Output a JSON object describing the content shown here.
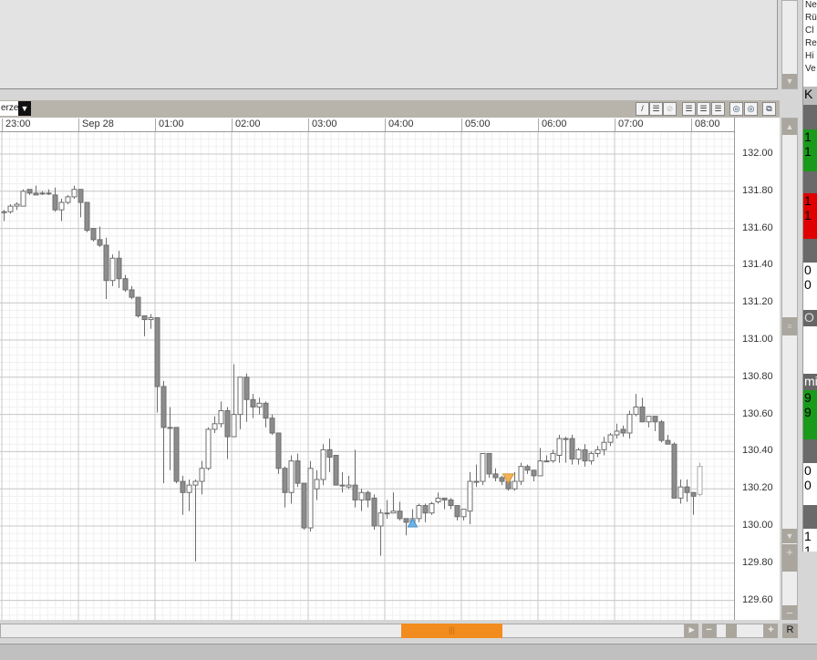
{
  "toolbar": {
    "instrument_label": "erze",
    "dropdown_icon": "▼",
    "tools": [
      "/",
      "☰",
      "⊘",
      "☰",
      "☰",
      "☰",
      "◎",
      "◎",
      "⧉"
    ]
  },
  "time_axis": {
    "labels": [
      "23:00",
      "Sep 28",
      "01:00",
      "02:00",
      "03:00",
      "04:00",
      "05:00",
      "06:00",
      "07:00",
      "08:00"
    ]
  },
  "price_axis": {
    "labels": [
      "132.00",
      "131.80",
      "131.60",
      "131.40",
      "131.20",
      "131.00",
      "130.80",
      "130.60",
      "130.40",
      "130.20",
      "130.00",
      "129.80",
      "129.60"
    ]
  },
  "scroll": {
    "thumb_grip": "|||",
    "reset_label": "R",
    "plus": "+",
    "minus": "−",
    "right_arrow": "▸"
  },
  "right_panel": {
    "rows": [
      "Ne",
      "Rü",
      "Cl",
      "Re",
      "Hi",
      "Ve"
    ],
    "header": "K",
    "blocks": [
      {
        "lines": [
          "1",
          "1"
        ],
        "color": "#1a9a1a",
        "fg": "#000"
      },
      {
        "lines": [
          "1",
          "1"
        ],
        "color": "#e00000",
        "fg": "#000"
      },
      {
        "lines": [
          "0",
          "0"
        ],
        "color": "#ffffff",
        "fg": "#000"
      },
      {
        "lines": [
          "O"
        ],
        "color": "#666666",
        "fg": "#ddd"
      },
      {
        "lines": [
          "mi"
        ],
        "color": "#666666",
        "fg": "#fff"
      },
      {
        "lines": [
          "9",
          "9"
        ],
        "color": "#1a9a1a",
        "fg": "#000"
      },
      {
        "lines": [
          "0",
          "0"
        ],
        "color": "#ffffff",
        "fg": "#000"
      },
      {
        "lines": [
          "1",
          "1"
        ],
        "color": "#ffffff",
        "fg": "#000"
      }
    ]
  },
  "chart_data": {
    "type": "candlestick",
    "interval": "5min",
    "ylim": [
      129.5,
      132.06
    ],
    "y_ticks": [
      132.0,
      131.8,
      131.6,
      131.4,
      131.2,
      131.0,
      130.8,
      130.6,
      130.4,
      130.2,
      130.0,
      129.8,
      129.6
    ],
    "colors": {
      "up_fill": "#ffffff",
      "down_fill": "#8c8c8c",
      "stroke": "#6e6e6e",
      "buy_marker": "#6cb4e8",
      "sell_marker": "#f2b456"
    },
    "markers": [
      {
        "index": 64,
        "type": "buy"
      },
      {
        "index": 79,
        "type": "sell"
      }
    ],
    "ohlc": [
      [
        131.69,
        131.7,
        131.64,
        131.69
      ],
      [
        131.69,
        131.73,
        131.68,
        131.72
      ],
      [
        131.72,
        131.74,
        131.7,
        131.73
      ],
      [
        131.72,
        131.81,
        131.72,
        131.8
      ],
      [
        131.81,
        131.81,
        131.78,
        131.79
      ],
      [
        131.79,
        131.83,
        131.78,
        131.78
      ],
      [
        131.79,
        131.8,
        131.78,
        131.79
      ],
      [
        131.79,
        131.81,
        131.78,
        131.79
      ],
      [
        131.78,
        131.82,
        131.69,
        131.7
      ],
      [
        131.7,
        131.76,
        131.64,
        131.74
      ],
      [
        131.74,
        131.78,
        131.73,
        131.77
      ],
      [
        131.77,
        131.83,
        131.76,
        131.81
      ],
      [
        131.81,
        131.81,
        131.66,
        131.74
      ],
      [
        131.74,
        131.74,
        131.58,
        131.59
      ],
      [
        131.6,
        131.6,
        131.53,
        131.54
      ],
      [
        131.54,
        131.61,
        131.5,
        131.51
      ],
      [
        131.51,
        131.55,
        131.22,
        131.32
      ],
      [
        131.32,
        131.46,
        131.29,
        131.44
      ],
      [
        131.44,
        131.48,
        131.28,
        131.33
      ],
      [
        131.33,
        131.35,
        131.26,
        131.27
      ],
      [
        131.27,
        131.29,
        131.22,
        131.23
      ],
      [
        131.23,
        131.23,
        131.12,
        131.13
      ],
      [
        131.13,
        131.13,
        131.02,
        131.11
      ],
      [
        131.11,
        131.14,
        131.06,
        131.12
      ],
      [
        131.12,
        131.12,
        130.61,
        130.75
      ],
      [
        130.75,
        130.78,
        130.23,
        130.53
      ],
      [
        130.53,
        130.64,
        130.3,
        130.53
      ],
      [
        130.53,
        130.53,
        130.23,
        130.24
      ],
      [
        130.24,
        130.27,
        130.06,
        130.18
      ],
      [
        130.18,
        130.25,
        130.08,
        130.22
      ],
      [
        130.22,
        130.25,
        129.81,
        130.24
      ],
      [
        130.24,
        130.35,
        130.17,
        130.31
      ],
      [
        130.31,
        130.53,
        130.3,
        130.52
      ],
      [
        130.52,
        130.59,
        130.5,
        130.55
      ],
      [
        130.55,
        130.67,
        130.53,
        130.62
      ],
      [
        130.62,
        130.64,
        130.36,
        130.48
      ],
      [
        130.48,
        130.87,
        130.48,
        130.6
      ],
      [
        130.6,
        130.8,
        130.52,
        130.8
      ],
      [
        130.8,
        130.82,
        130.56,
        130.68
      ],
      [
        130.68,
        130.71,
        130.58,
        130.64
      ],
      [
        130.64,
        130.69,
        130.6,
        130.66
      ],
      [
        130.66,
        130.67,
        130.53,
        130.58
      ],
      [
        130.58,
        130.6,
        130.49,
        130.5
      ],
      [
        130.5,
        130.5,
        130.28,
        130.31
      ],
      [
        130.31,
        130.32,
        130.1,
        130.18
      ],
      [
        130.18,
        130.38,
        130.12,
        130.35
      ],
      [
        130.35,
        130.39,
        130.21,
        130.23
      ],
      [
        130.23,
        130.23,
        129.98,
        129.99
      ],
      [
        129.99,
        130.35,
        129.97,
        130.31
      ],
      [
        130.2,
        130.3,
        130.14,
        130.25
      ],
      [
        130.25,
        130.44,
        130.22,
        130.41
      ],
      [
        130.41,
        130.47,
        130.29,
        130.37
      ],
      [
        130.38,
        130.38,
        130.22,
        130.22
      ],
      [
        130.22,
        130.29,
        130.18,
        130.22
      ],
      [
        130.21,
        130.27,
        130.2,
        130.22
      ],
      [
        130.22,
        130.41,
        130.1,
        130.14
      ],
      [
        130.14,
        130.2,
        130.08,
        130.18
      ],
      [
        130.18,
        130.19,
        130.1,
        130.14
      ],
      [
        130.15,
        130.17,
        129.98,
        130.0
      ],
      [
        130.0,
        130.09,
        129.84,
        130.07
      ],
      [
        130.07,
        130.14,
        130.04,
        130.07
      ],
      [
        130.07,
        130.18,
        130.07,
        130.08
      ],
      [
        130.08,
        130.13,
        130.03,
        130.04
      ],
      [
        130.04,
        130.04,
        129.95,
        130.02
      ],
      [
        130.02,
        130.09,
        130.01,
        130.04
      ],
      [
        130.04,
        130.12,
        130.02,
        130.11
      ],
      [
        130.11,
        130.12,
        130.02,
        130.07
      ],
      [
        130.07,
        130.13,
        130.06,
        130.12
      ],
      [
        130.13,
        130.18,
        130.12,
        130.15
      ],
      [
        130.15,
        130.15,
        130.09,
        130.14
      ],
      [
        130.14,
        130.15,
        130.09,
        130.11
      ],
      [
        130.11,
        130.11,
        130.03,
        130.05
      ],
      [
        130.05,
        130.09,
        130.03,
        130.09
      ],
      [
        130.08,
        130.29,
        130.01,
        130.24
      ],
      [
        130.24,
        130.33,
        130.21,
        130.24
      ],
      [
        130.24,
        130.39,
        130.22,
        130.39
      ],
      [
        130.39,
        130.39,
        130.26,
        130.28
      ],
      [
        130.28,
        130.31,
        130.24,
        130.26
      ],
      [
        130.26,
        130.27,
        130.22,
        130.24
      ],
      [
        130.24,
        130.27,
        130.19,
        130.2
      ],
      [
        130.2,
        130.29,
        130.19,
        130.24
      ],
      [
        130.24,
        130.34,
        130.22,
        130.32
      ],
      [
        130.32,
        130.33,
        130.28,
        130.3
      ],
      [
        130.3,
        130.3,
        130.24,
        130.27
      ],
      [
        130.27,
        130.42,
        130.27,
        130.35
      ],
      [
        130.35,
        130.38,
        130.35,
        130.35
      ],
      [
        130.35,
        130.41,
        130.34,
        130.39
      ],
      [
        130.38,
        130.49,
        130.34,
        130.47
      ],
      [
        130.47,
        130.48,
        130.34,
        130.47
      ],
      [
        130.47,
        130.49,
        130.33,
        130.36
      ],
      [
        130.36,
        130.42,
        130.33,
        130.41
      ],
      [
        130.41,
        130.44,
        130.32,
        130.35
      ],
      [
        130.35,
        130.4,
        130.33,
        130.39
      ],
      [
        130.39,
        130.43,
        130.37,
        130.41
      ],
      [
        130.41,
        130.48,
        130.38,
        130.45
      ],
      [
        130.45,
        130.5,
        130.43,
        130.49
      ],
      [
        130.49,
        130.55,
        130.47,
        130.51
      ],
      [
        130.52,
        130.54,
        130.48,
        130.5
      ],
      [
        130.5,
        130.62,
        130.47,
        130.6
      ],
      [
        130.6,
        130.71,
        130.59,
        130.64
      ],
      [
        130.64,
        130.69,
        130.56,
        130.56
      ],
      [
        130.56,
        130.59,
        130.53,
        130.59
      ],
      [
        130.59,
        130.59,
        130.51,
        130.56
      ],
      [
        130.56,
        130.57,
        130.45,
        130.46
      ],
      [
        130.46,
        130.49,
        130.44,
        130.44
      ],
      [
        130.44,
        130.45,
        130.15,
        130.15
      ],
      [
        130.15,
        130.25,
        130.12,
        130.21
      ],
      [
        130.21,
        130.25,
        130.13,
        130.18
      ],
      [
        130.18,
        130.18,
        130.06,
        130.16
      ],
      [
        130.17,
        130.34,
        130.16,
        130.32
      ]
    ]
  }
}
